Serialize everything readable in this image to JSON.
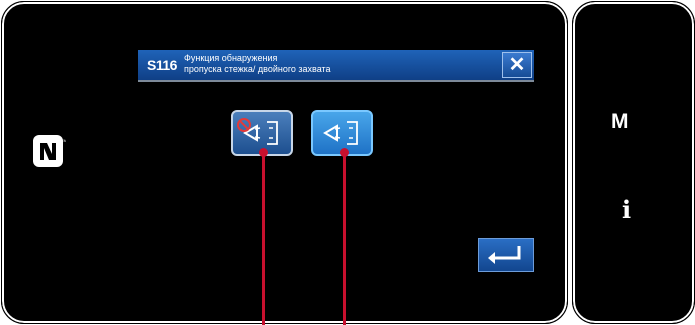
{
  "header": {
    "screen_code": "S116",
    "title": "Функция обнаружения\nпропуска стежка/ двойного захвата",
    "close_label": "✕"
  },
  "buttons": {
    "detect_off_icon": "stitch-detection-off-icon",
    "detect_on_icon": "stitch-detection-on-icon",
    "enter_icon": "enter-icon"
  },
  "side": {
    "menu_label": "M",
    "info_label": "i",
    "nfc_icon": "nfc-icon"
  },
  "colors": {
    "title_bar": "#1f63b8",
    "callout": "#c8102e",
    "background": "#000000"
  }
}
